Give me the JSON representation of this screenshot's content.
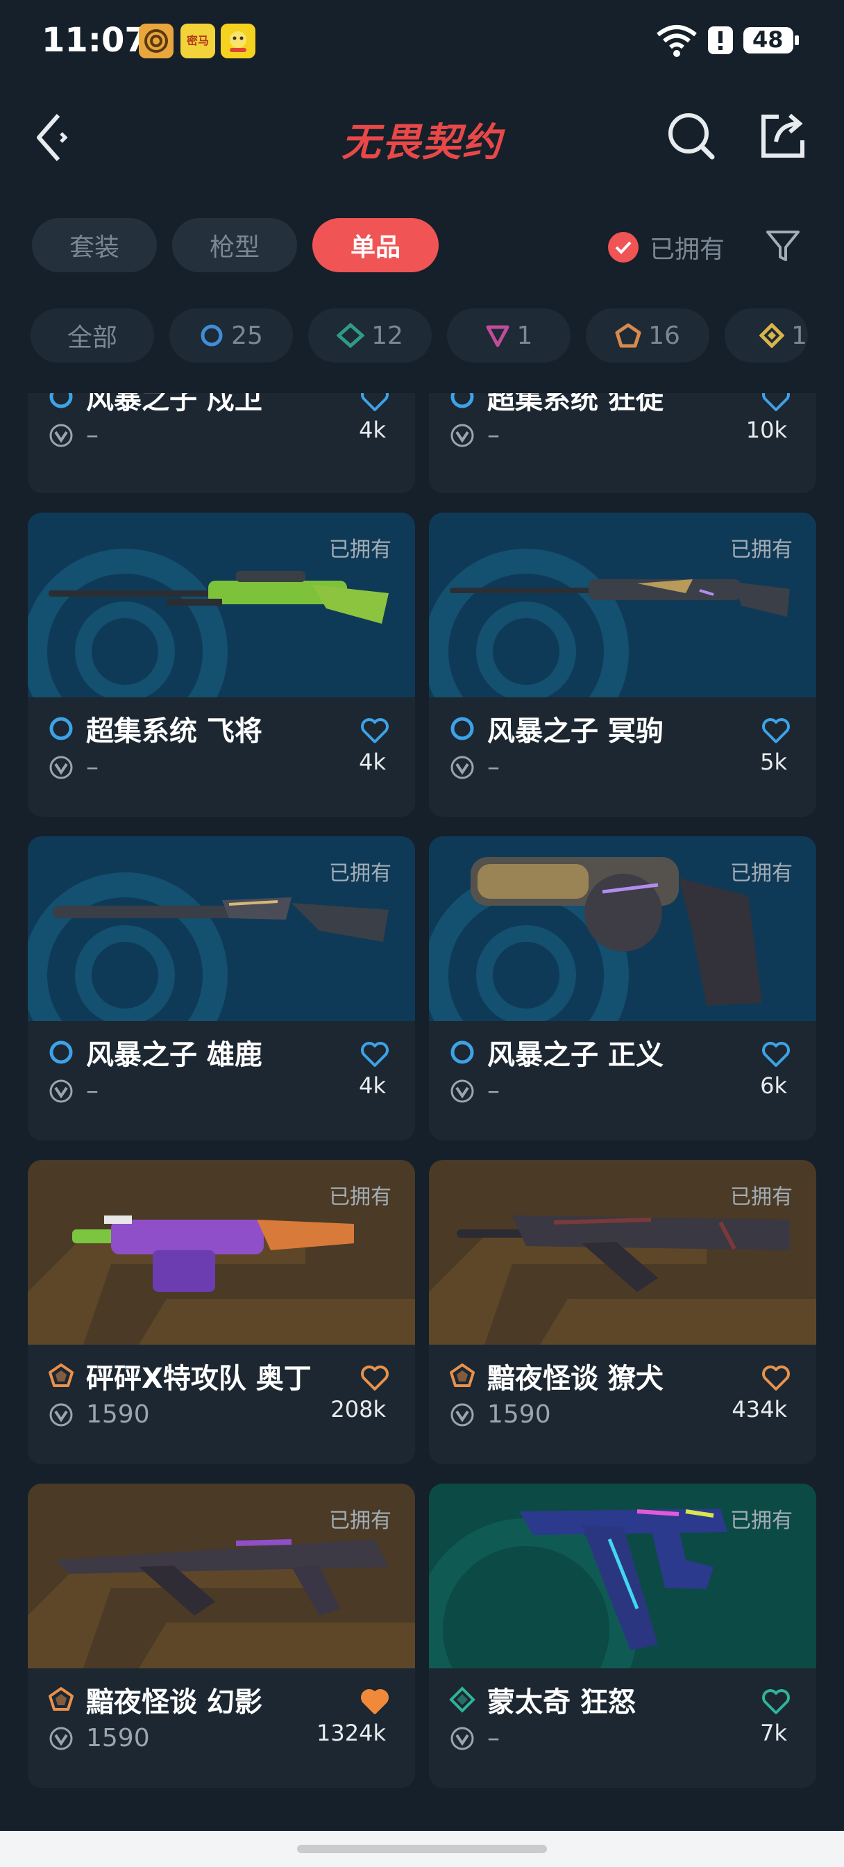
{
  "status_bar": {
    "time": "11:07",
    "apps": [
      {
        "icon": "target-app-icon",
        "label": "",
        "color": "#e8a23c"
      },
      {
        "icon": "mima-app-icon",
        "label": "密马",
        "color": "#f3d33a"
      },
      {
        "icon": "pet-app-icon",
        "label": "",
        "color": "#f5d21f"
      }
    ],
    "battery": "48"
  },
  "header": {
    "title": "无畏契约",
    "back_icon": "back-chevron-icon",
    "search_icon": "search-icon",
    "share_icon": "share-icon"
  },
  "type_tabs": [
    {
      "label": "套装",
      "active": false
    },
    {
      "label": "枪型",
      "active": false
    },
    {
      "label": "单品",
      "active": true
    }
  ],
  "owned_filter": {
    "label": "已拥有",
    "checked": true
  },
  "tier_chips": [
    {
      "label": "全部",
      "count": "",
      "tier": "all"
    },
    {
      "label": "",
      "count": "25",
      "tier": "select",
      "color": "#3f8fd8"
    },
    {
      "label": "",
      "count": "12",
      "tier": "deluxe",
      "color": "#2f9b86"
    },
    {
      "label": "",
      "count": "1",
      "tier": "premium",
      "color": "#c14c9a"
    },
    {
      "label": "",
      "count": "16",
      "tier": "ultra",
      "color": "#d68a4e"
    },
    {
      "label": "",
      "count": "1",
      "tier": "exclusive",
      "color": "#d8b54b"
    }
  ],
  "colors": {
    "accent": "#f05454",
    "select_blue": "#3ea2e6",
    "ultra_orange": "#e8914c",
    "deluxe_teal": "#2fb39a"
  },
  "items": [
    {
      "name": "风暴之子 戍卫",
      "price": "–",
      "likes": "4k",
      "tier": "select",
      "owned_label": "",
      "liked": false,
      "bg": "blue"
    },
    {
      "name": "超集系统 狂徒",
      "price": "–",
      "likes": "10k",
      "tier": "select",
      "owned_label": "",
      "liked": false,
      "bg": "blue"
    },
    {
      "name": "超集系统 飞将",
      "price": "–",
      "likes": "4k",
      "tier": "select",
      "owned_label": "已拥有",
      "liked": false,
      "bg": "blue"
    },
    {
      "name": "风暴之子 冥驹",
      "price": "–",
      "likes": "5k",
      "tier": "select",
      "owned_label": "已拥有",
      "liked": false,
      "bg": "blue"
    },
    {
      "name": "风暴之子 雄鹿",
      "price": "–",
      "likes": "4k",
      "tier": "select",
      "owned_label": "已拥有",
      "liked": false,
      "bg": "blue"
    },
    {
      "name": "风暴之子 正义",
      "price": "–",
      "likes": "6k",
      "tier": "select",
      "owned_label": "已拥有",
      "liked": false,
      "bg": "blue"
    },
    {
      "name": "砰砰X特攻队 奥丁",
      "price": "1590",
      "likes": "208k",
      "tier": "ultra",
      "owned_label": "已拥有",
      "liked": false,
      "bg": "orange"
    },
    {
      "name": "黯夜怪谈 獠犬",
      "price": "1590",
      "likes": "434k",
      "tier": "ultra",
      "owned_label": "已拥有",
      "liked": false,
      "bg": "orange"
    },
    {
      "name": "黯夜怪谈 幻影",
      "price": "1590",
      "likes": "1324k",
      "tier": "ultra",
      "owned_label": "已拥有",
      "liked": true,
      "bg": "orange"
    },
    {
      "name": "蒙太奇 狂怒",
      "price": "–",
      "likes": "7k",
      "tier": "deluxe",
      "owned_label": "已拥有",
      "liked": false,
      "bg": "teal"
    }
  ]
}
